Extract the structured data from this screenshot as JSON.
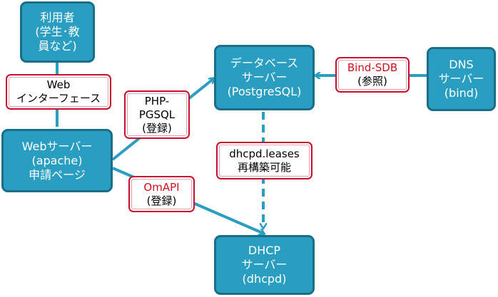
{
  "nodes": {
    "user": {
      "lines": [
        "利用者",
        "(学生･教",
        "員など)"
      ]
    },
    "web": {
      "lines": [
        "Webサーバー",
        "(apache)",
        "申請ページ"
      ]
    },
    "db": {
      "lines": [
        "データベース",
        "サーバー",
        "(PostgreSQL)"
      ]
    },
    "dns": {
      "lines": [
        "DNS",
        "サーバー",
        "(bind)"
      ]
    },
    "dhcp": {
      "lines": [
        "DHCP",
        "サーバー",
        "(dhcpd)"
      ]
    }
  },
  "labels": {
    "web_interface": {
      "lines": [
        "Web",
        "インターフェース"
      ]
    },
    "php_pgsql": {
      "lines": [
        "PHP-",
        "PGSQL",
        "(登録)"
      ]
    },
    "bind_sdb": {
      "lines": [
        "Bind-SDB",
        "(参照)"
      ]
    },
    "dhcpd_leases": {
      "lines": [
        "dhcpd.leases",
        "再構築可能"
      ]
    },
    "omapi": {
      "lines": [
        "OmAPI",
        "(登録)"
      ]
    }
  },
  "colors": {
    "node_fill": "#2a9ec0",
    "node_border": "#1a6e8a",
    "connector": "#2a9ec0",
    "label_border": "#c8102e",
    "highlight_text": "#d0101e"
  }
}
